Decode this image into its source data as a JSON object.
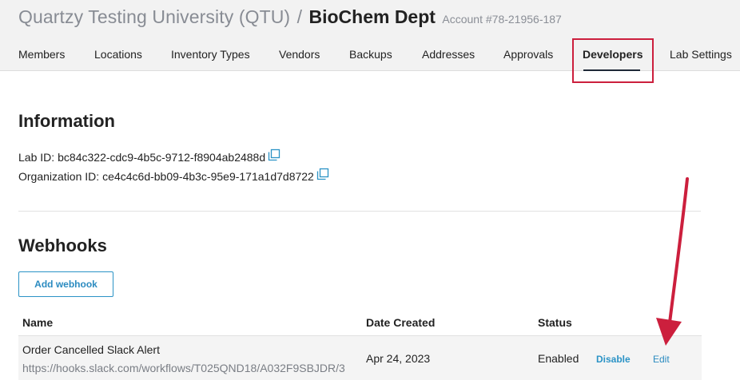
{
  "header": {
    "org_name": "Quartzy Testing University (QTU)",
    "separator": "/",
    "dept_name": "BioChem Dept",
    "account": "Account #78-21956-187"
  },
  "tabs": [
    {
      "label": "Members",
      "active": false
    },
    {
      "label": "Locations",
      "active": false
    },
    {
      "label": "Inventory Types",
      "active": false
    },
    {
      "label": "Vendors",
      "active": false
    },
    {
      "label": "Backups",
      "active": false
    },
    {
      "label": "Addresses",
      "active": false
    },
    {
      "label": "Approvals",
      "active": false
    },
    {
      "label": "Developers",
      "active": true
    },
    {
      "label": "Lab Settings",
      "active": false
    }
  ],
  "information": {
    "heading": "Information",
    "lab_id_label": "Lab ID:",
    "lab_id_value": "bc84c322-cdc9-4b5c-9712-f8904ab2488d",
    "org_id_label": "Organization ID:",
    "org_id_value": "ce4c4c6d-bb09-4b3c-95e9-171a1d7d8722"
  },
  "webhooks": {
    "heading": "Webhooks",
    "add_button": "Add webhook",
    "columns": {
      "name": "Name",
      "date": "Date Created",
      "status": "Status"
    },
    "rows": [
      {
        "name": "Order Cancelled Slack Alert",
        "url": "https://hooks.slack.com/workflows/T025QND18/A032F9SBJDR/3",
        "date": "Apr 24, 2023",
        "status": "Enabled",
        "disable_label": "Disable",
        "edit_label": "Edit"
      }
    ]
  },
  "colors": {
    "accent": "#2b93c6",
    "annotation": "#cc1f3d"
  },
  "icons": {
    "copy": "copy-icon"
  }
}
